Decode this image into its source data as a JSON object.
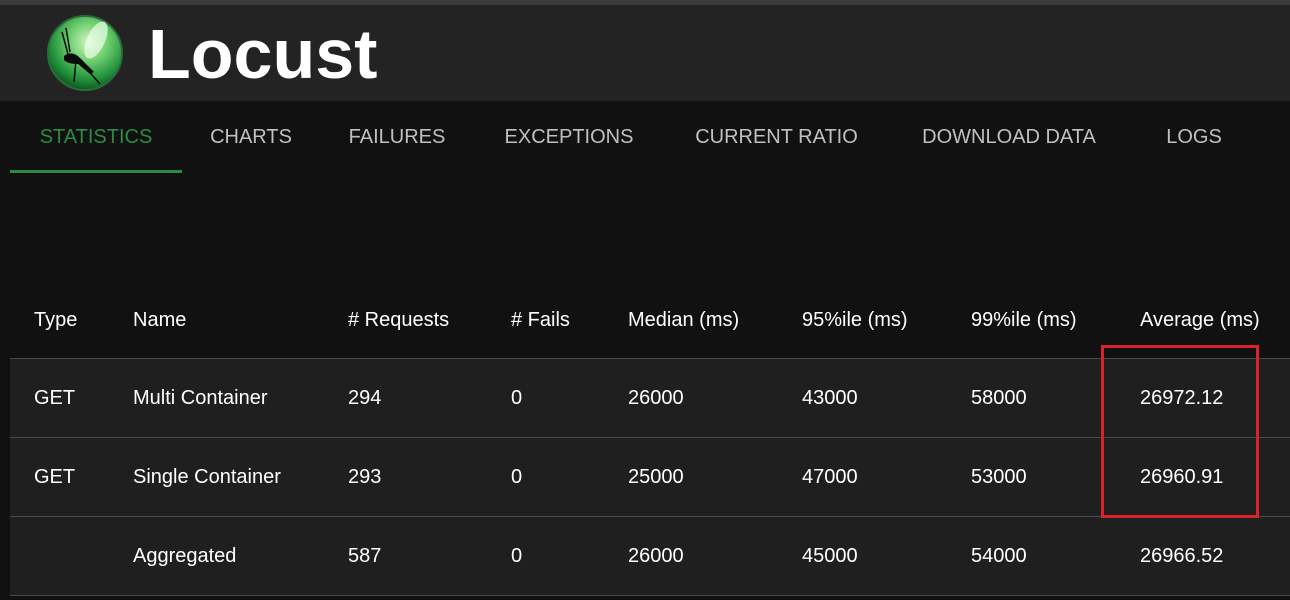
{
  "app": {
    "title": "Locust",
    "logo_icon": "locust-logo-icon"
  },
  "nav": {
    "tabs": [
      {
        "label": "STATISTICS",
        "active": true
      },
      {
        "label": "CHARTS",
        "active": false
      },
      {
        "label": "FAILURES",
        "active": false
      },
      {
        "label": "EXCEPTIONS",
        "active": false
      },
      {
        "label": "CURRENT RATIO",
        "active": false
      },
      {
        "label": "DOWNLOAD DATA",
        "active": false
      },
      {
        "label": "LOGS",
        "active": false
      }
    ]
  },
  "stats": {
    "headers": [
      "Type",
      "Name",
      "# Requests",
      "# Fails",
      "Median (ms)",
      "95%ile (ms)",
      "99%ile (ms)",
      "Average (ms)"
    ],
    "rows": [
      {
        "type": "GET",
        "name": "Multi Container",
        "requests": "294",
        "fails": "0",
        "median": "26000",
        "p95": "43000",
        "p99": "58000",
        "average": "26972.12"
      },
      {
        "type": "GET",
        "name": "Single Container",
        "requests": "293",
        "fails": "0",
        "median": "25000",
        "p95": "47000",
        "p99": "53000",
        "average": "26960.91"
      },
      {
        "type": "",
        "name": "Aggregated",
        "requests": "587",
        "fails": "0",
        "median": "26000",
        "p95": "45000",
        "p99": "54000",
        "average": "26966.52"
      }
    ]
  },
  "colors": {
    "accent": "#2c8a46",
    "highlight": "#d9232b",
    "header_bg": "#232323",
    "page_bg": "#111111",
    "row_bg": "#1f1f1f"
  }
}
